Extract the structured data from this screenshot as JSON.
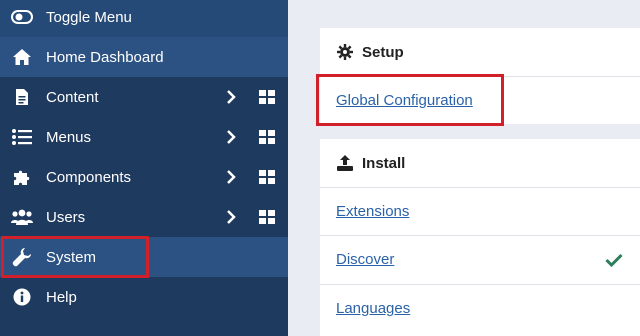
{
  "sidebar": {
    "items": [
      {
        "label": "Toggle Menu",
        "icon": "toggle-icon"
      },
      {
        "label": "Home Dashboard",
        "icon": "home-icon"
      },
      {
        "label": "Content",
        "icon": "file-icon"
      },
      {
        "label": "Menus",
        "icon": "list-icon"
      },
      {
        "label": "Components",
        "icon": "puzzle-icon"
      },
      {
        "label": "Users",
        "icon": "users-icon"
      },
      {
        "label": "System",
        "icon": "wrench-icon"
      },
      {
        "label": "Help",
        "icon": "info-icon"
      }
    ]
  },
  "setup": {
    "title": "Setup",
    "links": [
      {
        "label": "Global Configuration"
      }
    ]
  },
  "install": {
    "title": "Install",
    "links": [
      {
        "label": "Extensions"
      },
      {
        "label": "Discover"
      },
      {
        "label": "Languages"
      }
    ]
  },
  "colors": {
    "sidebar_bg": "#1f3a5f",
    "sidebar_active": "#2b5282",
    "link": "#2a62a8",
    "highlight": "#d2202b",
    "check": "#2e7d5b"
  }
}
